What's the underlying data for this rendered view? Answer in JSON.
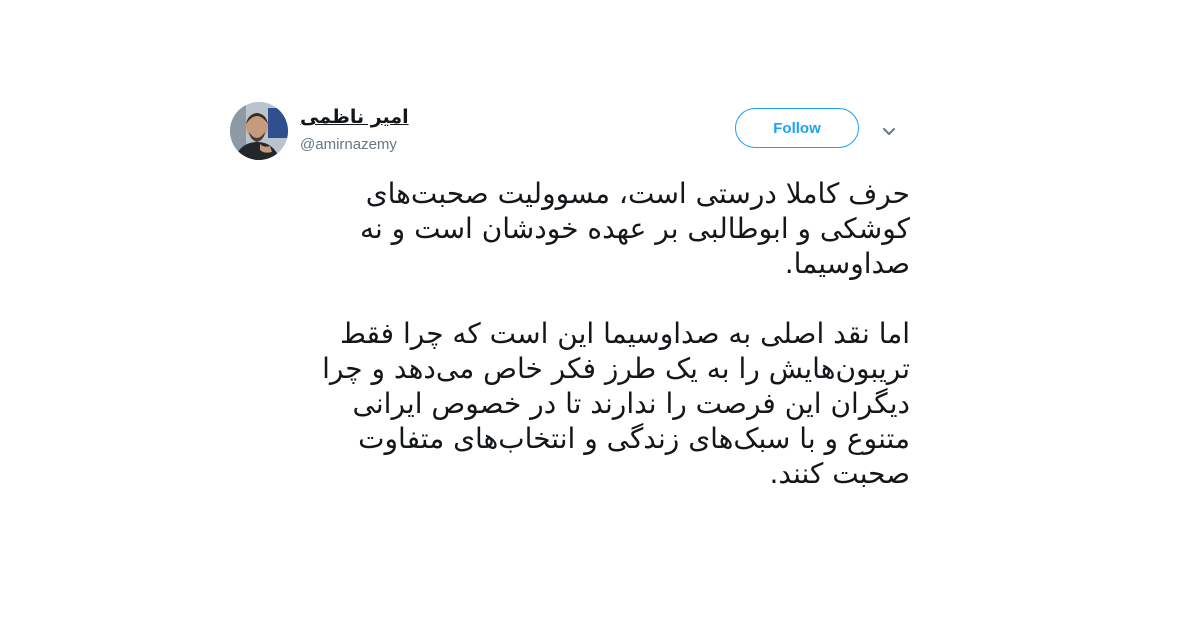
{
  "tweet": {
    "author": {
      "display_name": "امیر ناظمی",
      "handle": "@amirnazemy",
      "avatar_icon": "profile-photo"
    },
    "follow_label": "Follow",
    "menu_icon": "chevron-down-icon",
    "accent_color": "#1da1f2",
    "paragraphs": [
      {
        "lines": [
          "حرف کاملا درستی است، مسوولیت صحبت‌های",
          "کوشکی و ابوطالبی بر عهده خودشان است و نه",
          "صداوسیما."
        ]
      },
      {
        "lines": [
          "اما نقد اصلی به صداوسیما این است که چرا فقط",
          "تریبون‌هایش را به یک طرز فکر خاص می‌دهد و چرا",
          "دیگران این فرصت را ندارند تا در خصوص ایرانی",
          "متنوع و با سبک‌های زندگی و انتخاب‌های متفاوت",
          "صحبت کنند."
        ]
      }
    ]
  }
}
